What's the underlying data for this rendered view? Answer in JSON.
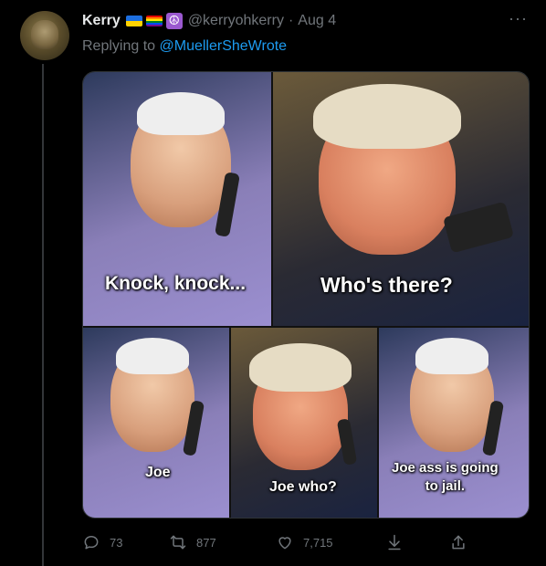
{
  "tweet": {
    "display_name": "Kerry",
    "handle": "@kerryohkerry",
    "separator": "·",
    "date": "Aug 4",
    "replying_prefix": "Replying to ",
    "replying_to": "@MuellerSheWrote",
    "more_label": "···",
    "name_emojis": [
      "ukraine-flag",
      "rainbow-flag",
      "peace-symbol"
    ]
  },
  "meme": {
    "captions": {
      "panel1": "Knock, knock...",
      "panel2": "Who's there?",
      "panel3": "Joe",
      "panel4": "Joe who?",
      "panel5_line1": "Joe ass is going",
      "panel5_line2": "to jail."
    }
  },
  "actions": {
    "replies": "73",
    "retweets": "877",
    "likes": "7,715"
  },
  "colors": {
    "background": "#000000",
    "text_primary": "#e7e9ea",
    "text_secondary": "#71767b",
    "accent": "#1d9bf0"
  }
}
